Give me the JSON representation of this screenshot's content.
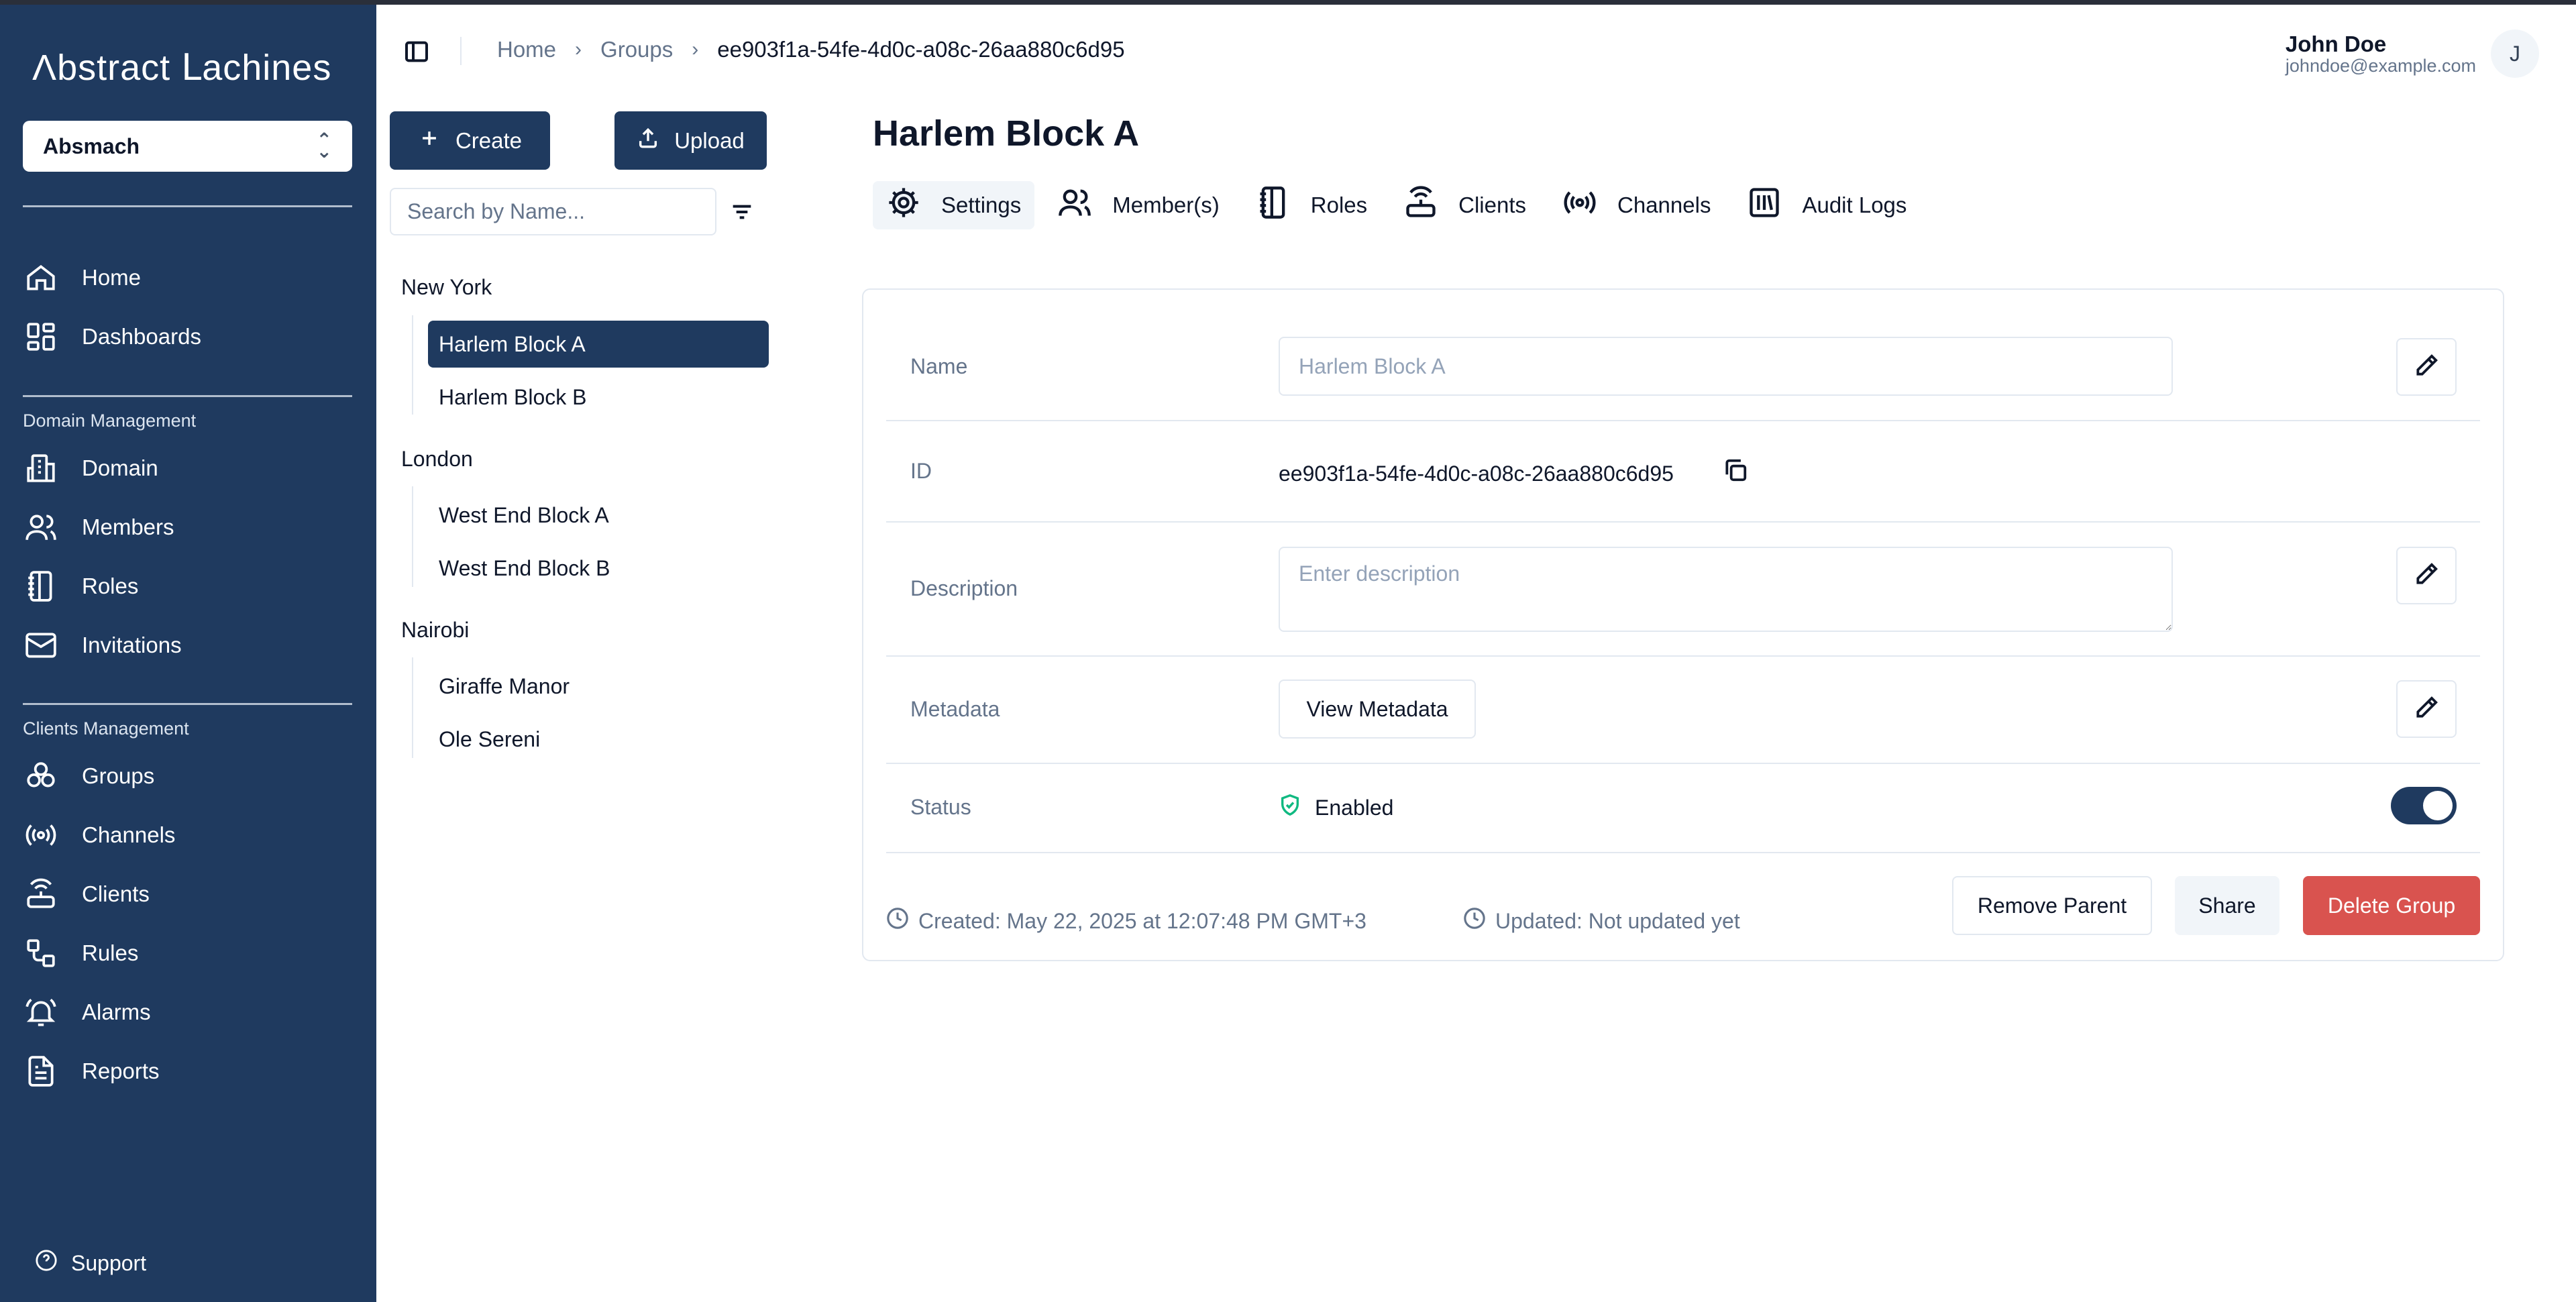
{
  "app": {
    "logo_text": "Λbstract Ⅼachines"
  },
  "sidebar": {
    "domain_select": "Absmach",
    "items_main": [
      {
        "label": "Home",
        "icon": "home-icon"
      },
      {
        "label": "Dashboards",
        "icon": "dashboard-icon"
      }
    ],
    "section_domain": "Domain Management",
    "items_domain": [
      {
        "label": "Domain",
        "icon": "building-icon"
      },
      {
        "label": "Members",
        "icon": "users-icon"
      },
      {
        "label": "Roles",
        "icon": "notebook-icon"
      },
      {
        "label": "Invitations",
        "icon": "mail-icon"
      }
    ],
    "section_clients": "Clients Management",
    "items_clients": [
      {
        "label": "Groups",
        "icon": "groups-icon"
      },
      {
        "label": "Channels",
        "icon": "broadcast-icon"
      },
      {
        "label": "Clients",
        "icon": "router-icon"
      },
      {
        "label": "Rules",
        "icon": "workflow-icon"
      },
      {
        "label": "Alarms",
        "icon": "bell-icon"
      },
      {
        "label": "Reports",
        "icon": "report-icon"
      }
    ],
    "support": "Support"
  },
  "topbar": {
    "breadcrumb": [
      "Home",
      "Groups",
      "ee903f1a-54fe-4d0c-a08c-26aa880c6d95"
    ],
    "user": {
      "name": "John Doe",
      "email": "johndoe@example.com",
      "initial": "J"
    }
  },
  "tree": {
    "create_label": "Create",
    "upload_label": "Upload",
    "search_placeholder": "Search by Name...",
    "groups": [
      {
        "name": "New York",
        "children": [
          "Harlem Block A",
          "Harlem Block B"
        ]
      },
      {
        "name": "London",
        "children": [
          "West End Block A",
          "West End Block B"
        ]
      },
      {
        "name": "Nairobi",
        "children": [
          "Giraffe Manor",
          "Ole Sereni"
        ]
      }
    ],
    "selected": "Harlem Block A"
  },
  "main": {
    "title": "Harlem Block A",
    "tabs": [
      "Settings",
      "Member(s)",
      "Roles",
      "Clients",
      "Channels",
      "Audit Logs"
    ],
    "active_tab": "Settings",
    "fields": {
      "name_label": "Name",
      "name_placeholder": "Harlem Block A",
      "id_label": "ID",
      "id_value": "ee903f1a-54fe-4d0c-a08c-26aa880c6d95",
      "description_label": "Description",
      "description_placeholder": "Enter description",
      "metadata_label": "Metadata",
      "metadata_button": "View Metadata",
      "status_label": "Status",
      "status_value": "Enabled",
      "status_enabled": true
    },
    "footer": {
      "created": "Created: May 22, 2025 at 12:07:48 PM GMT+3",
      "updated": "Updated: Not updated yet",
      "remove_parent": "Remove Parent",
      "share": "Share",
      "delete": "Delete Group"
    },
    "colors": {
      "brand": "#1f3a5f",
      "danger": "#d9534f",
      "success": "#10b981"
    }
  }
}
